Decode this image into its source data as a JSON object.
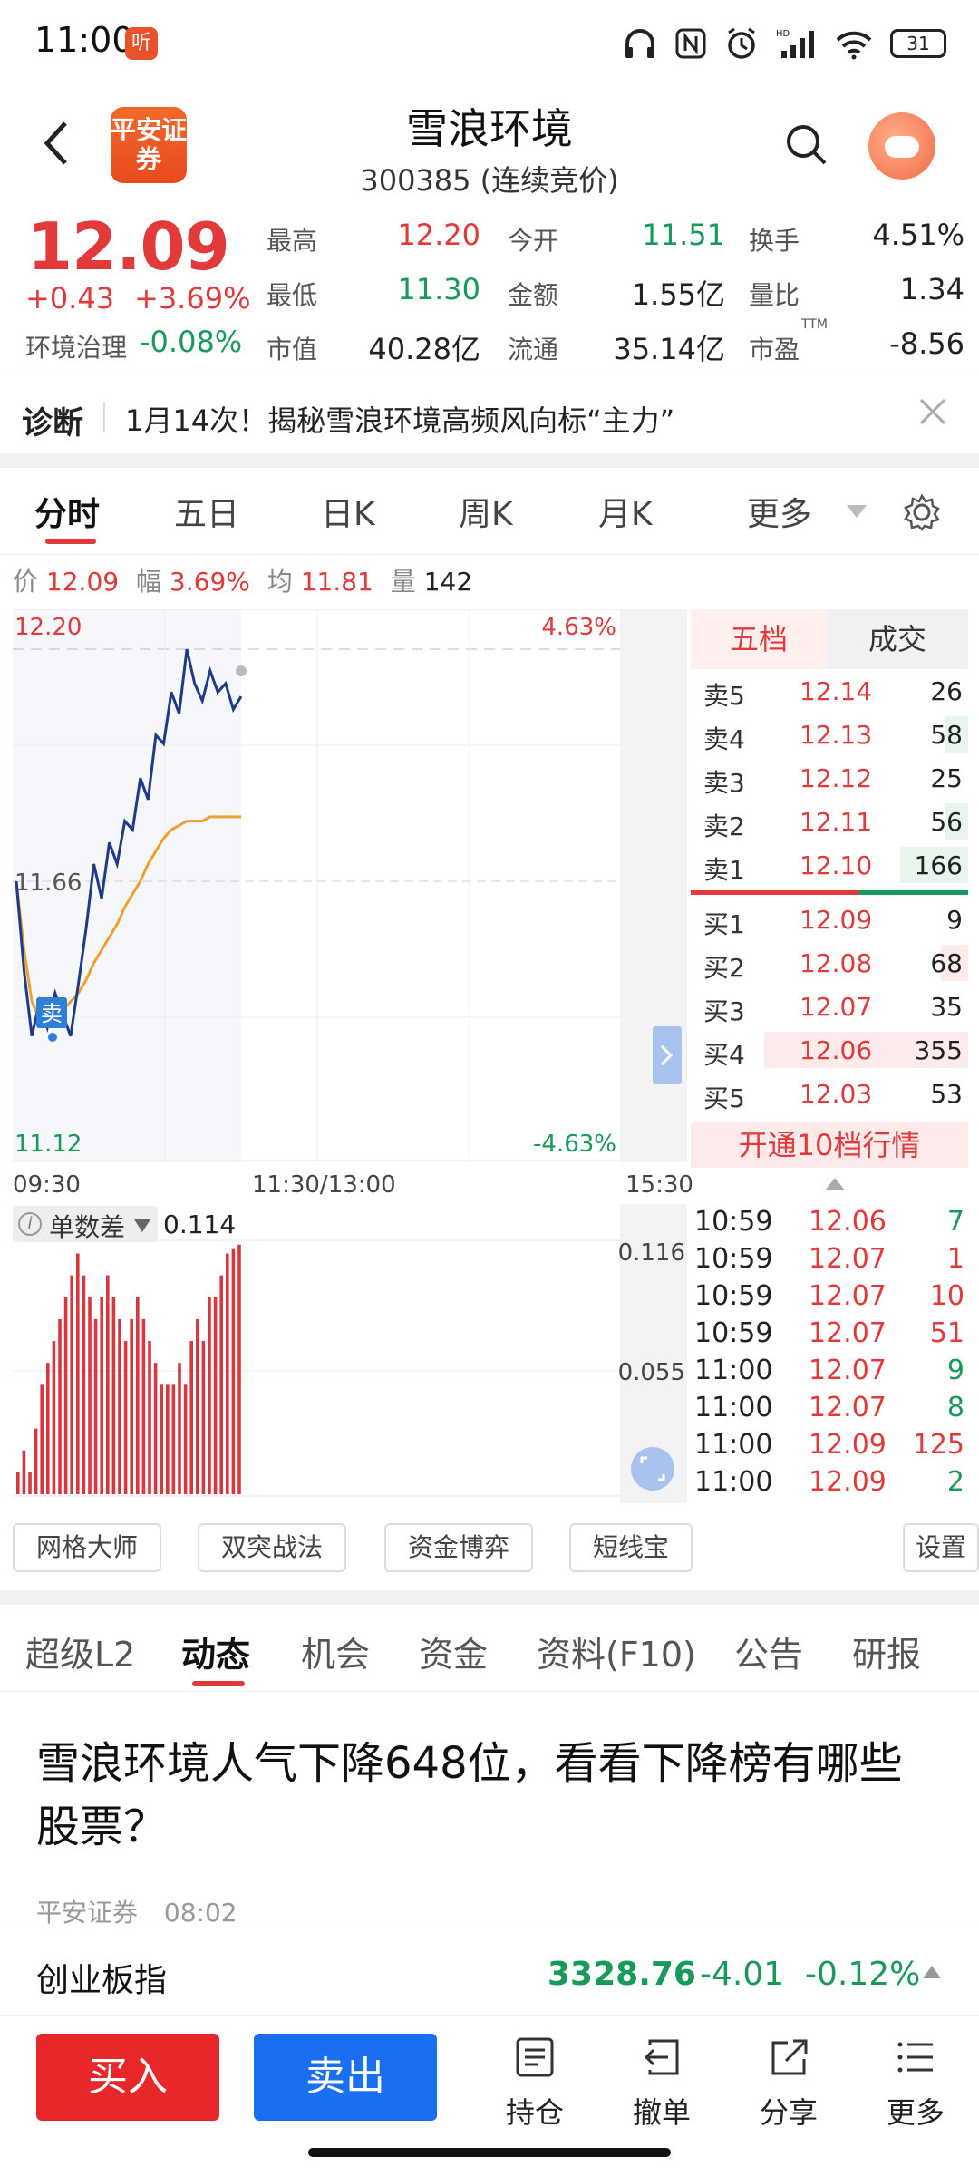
{
  "status": {
    "time": "11:00",
    "app_badge": "听",
    "battery": "31"
  },
  "header": {
    "title": "雪浪环境",
    "subtitle": "300385 (连续竞价)",
    "broker_logo": "平安证券"
  },
  "quote": {
    "price": "12.09",
    "change": "+0.43",
    "change_pct": "+3.69%",
    "sector_name": "环境治理",
    "sector_change": "-0.08%",
    "fields": [
      {
        "label": "最高",
        "value": "12.20",
        "color": "red"
      },
      {
        "label": "今开",
        "value": "11.51",
        "color": "green"
      },
      {
        "label": "换手",
        "value": "4.51%",
        "color": "black"
      },
      {
        "label": "最低",
        "value": "11.30",
        "color": "green"
      },
      {
        "label": "金额",
        "value": "1.55亿",
        "color": "black"
      },
      {
        "label": "量比",
        "value": "1.34",
        "color": "black"
      },
      {
        "label": "市值",
        "value": "40.28亿",
        "color": "black"
      },
      {
        "label": "流通",
        "value": "35.14亿",
        "color": "black"
      },
      {
        "label": "市盈",
        "value": "-8.56",
        "color": "black"
      }
    ],
    "pe_sup": "TTM"
  },
  "diagnosis": {
    "label": "诊断",
    "text": "1月14次！揭秘雪浪环境高频风向标“主力”"
  },
  "chart_tabs": [
    "分时",
    "五日",
    "日K",
    "周K",
    "月K",
    "更多"
  ],
  "info": {
    "price_label": "价",
    "price": "12.09",
    "pct_label": "幅",
    "pct": "3.69%",
    "avg_label": "均",
    "avg": "11.81",
    "vol_label": "量",
    "vol": "142"
  },
  "chart_labels": {
    "top_price": "12.20",
    "mid_price": "11.66",
    "bottom_price": "11.12",
    "top_pct": "4.63%",
    "bottom_pct": "-4.63%",
    "time_start": "09:30",
    "time_mid": "11:30/13:00",
    "time_end": "15:30",
    "sell_marker": "卖"
  },
  "book_tabs": {
    "five": "五档",
    "trades": "成交"
  },
  "order_book": {
    "asks": [
      {
        "label": "卖5",
        "price": "12.14",
        "vol": "26",
        "bar": 0.0
      },
      {
        "label": "卖4",
        "price": "12.13",
        "vol": "58",
        "bar": 0.1
      },
      {
        "label": "卖3",
        "price": "12.12",
        "vol": "25",
        "bar": 0.0
      },
      {
        "label": "卖2",
        "price": "12.11",
        "vol": "56",
        "bar": 0.1
      },
      {
        "label": "卖1",
        "price": "12.10",
        "vol": "166",
        "bar": 0.3
      }
    ],
    "bids": [
      {
        "label": "买1",
        "price": "12.09",
        "vol": "9",
        "bar": 0.0
      },
      {
        "label": "买2",
        "price": "12.08",
        "vol": "68",
        "bar": 0.12
      },
      {
        "label": "买3",
        "price": "12.07",
        "vol": "35",
        "bar": 0.0
      },
      {
        "label": "买4",
        "price": "12.06",
        "vol": "355",
        "bar": 0.9
      },
      {
        "label": "买5",
        "price": "12.03",
        "vol": "53",
        "bar": 0.0
      }
    ],
    "open10": "开通10档行情"
  },
  "indicator": {
    "name": "单数差",
    "value": "0.114",
    "top": "0.116",
    "mid": "0.055"
  },
  "ticks": [
    {
      "time": "10:59",
      "price": "12.06",
      "vol": "7",
      "color": "green"
    },
    {
      "time": "10:59",
      "price": "12.07",
      "vol": "1",
      "color": "red"
    },
    {
      "time": "10:59",
      "price": "12.07",
      "vol": "10",
      "color": "red"
    },
    {
      "time": "10:59",
      "price": "12.07",
      "vol": "51",
      "color": "red"
    },
    {
      "time": "11:00",
      "price": "12.07",
      "vol": "9",
      "color": "green"
    },
    {
      "time": "11:00",
      "price": "12.07",
      "vol": "8",
      "color": "green"
    },
    {
      "time": "11:00",
      "price": "12.09",
      "vol": "125",
      "color": "red"
    },
    {
      "time": "11:00",
      "price": "12.09",
      "vol": "2",
      "color": "green"
    }
  ],
  "tools": [
    "网格大师",
    "双突战法",
    "资金博弈",
    "短线宝",
    "设置"
  ],
  "news_tabs": [
    "超级L2",
    "动态",
    "机会",
    "资金",
    "资料(F10)",
    "公告",
    "研报"
  ],
  "article": {
    "title": "雪浪环境人气下降648位，看看下降榜有哪些股票？",
    "source": "平安证券",
    "time": "08:02"
  },
  "index_bar": {
    "name": "创业板指",
    "value": "3328.76",
    "change": "-4.01",
    "pct": "-0.12%"
  },
  "bottom": {
    "buy": "买入",
    "sell": "卖出",
    "hold": "持仓",
    "cancel": "撤单",
    "share": "分享",
    "more": "更多"
  },
  "colors": {
    "red": "#e23a3a",
    "green": "#1a9a5a",
    "price_line": "#1e3a8a",
    "avg_line": "#f0a030",
    "buy_btn": "#e8272a",
    "sell_btn": "#1a6ef0"
  },
  "chart_data": {
    "type": "line",
    "ylim": [
      11.12,
      12.2
    ],
    "series": [
      {
        "values": [
          11.66,
          11.45,
          11.3,
          11.38,
          11.32,
          11.4,
          11.35,
          11.3,
          11.42,
          11.55,
          11.7,
          11.62,
          11.75,
          11.7,
          11.8,
          11.78,
          11.9,
          11.85,
          12.0,
          11.98,
          12.1,
          12.05,
          12.2,
          12.12,
          12.08,
          12.15,
          12.1,
          12.12,
          12.06,
          12.09
        ]
      },
      {
        "values": [
          11.66,
          11.5,
          11.38,
          11.34,
          11.33,
          11.34,
          11.36,
          11.38,
          11.4,
          11.43,
          11.47,
          11.5,
          11.53,
          11.56,
          11.6,
          11.63,
          11.66,
          11.7,
          11.73,
          11.76,
          11.78,
          11.79,
          11.8,
          11.8,
          11.8,
          11.81,
          11.81,
          11.81,
          11.81,
          11.81
        ]
      }
    ],
    "bars": [
      0.01,
      0.02,
      0.01,
      0.03,
      0.05,
      0.06,
      0.07,
      0.08,
      0.09,
      0.1,
      0.11,
      0.1,
      0.09,
      0.08,
      0.09,
      0.1,
      0.09,
      0.08,
      0.07,
      0.08,
      0.09,
      0.08,
      0.07,
      0.06,
      0.05,
      0.05,
      0.05,
      0.06,
      0.05,
      0.07,
      0.08,
      0.07,
      0.09,
      0.09,
      0.1,
      0.11,
      0.112,
      0.114
    ]
  }
}
